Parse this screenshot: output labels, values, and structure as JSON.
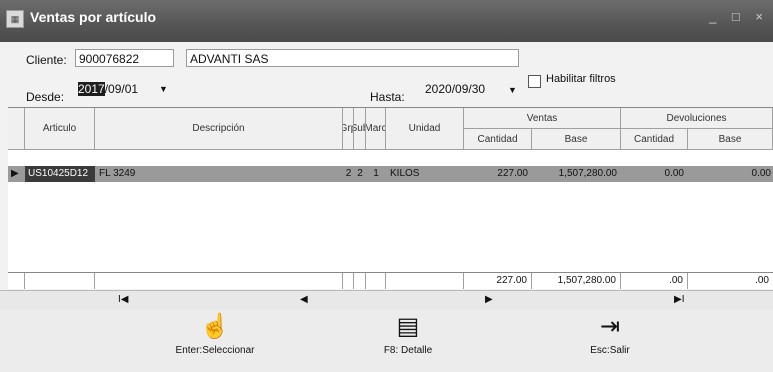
{
  "window": {
    "title": "Ventas por artículo",
    "controls": "_ □ ×"
  },
  "filters": {
    "cliente_label": "Cliente:",
    "cliente_code": "900076822",
    "cliente_name": "ADVANTI SAS",
    "desde_label": "Desde:",
    "desde_year": "2017",
    "desde_rest": "/09/01",
    "hasta_label": "Hasta:",
    "hasta_value": "2020/09/30",
    "habilitar_label": "Habilitar filtros"
  },
  "grid": {
    "headers": {
      "articulo": "Articulo",
      "descripcion": "Descripción",
      "grp": "Grp",
      "sub": "Sub",
      "marc": "Marc",
      "unidad": "Unidad",
      "ventas": "Ventas",
      "devoluciones": "Devoluciones",
      "cantidad": "Cantidad",
      "base": "Base",
      "dev_cantidad": "Cantidad",
      "dev_base": "Base"
    },
    "rows": [
      {
        "articulo": "US10425D12",
        "descripcion": "FL 3249",
        "grp": "2",
        "sub": "2",
        "marc": "1",
        "unidad": "KILOS",
        "cantidad": "227.00",
        "base": "1,507,280.00",
        "dev_cantidad": "0.00",
        "dev_base": "0.00"
      }
    ],
    "totals": {
      "cantidad": "227.00",
      "base": "1,507,280.00",
      "dev_cantidad": ".00",
      "dev_base": ".00"
    }
  },
  "nav": {
    "first": "I◀",
    "prev": "◀",
    "next": "▶",
    "last": "▶I"
  },
  "actions": {
    "select": {
      "label": "Enter:Seleccionar",
      "icon": "hand-pointer-icon"
    },
    "detail": {
      "label": "F8: Detalle",
      "icon": "document-icon"
    },
    "exit": {
      "label": "Esc:Salir",
      "icon": "exit-door-icon"
    }
  }
}
